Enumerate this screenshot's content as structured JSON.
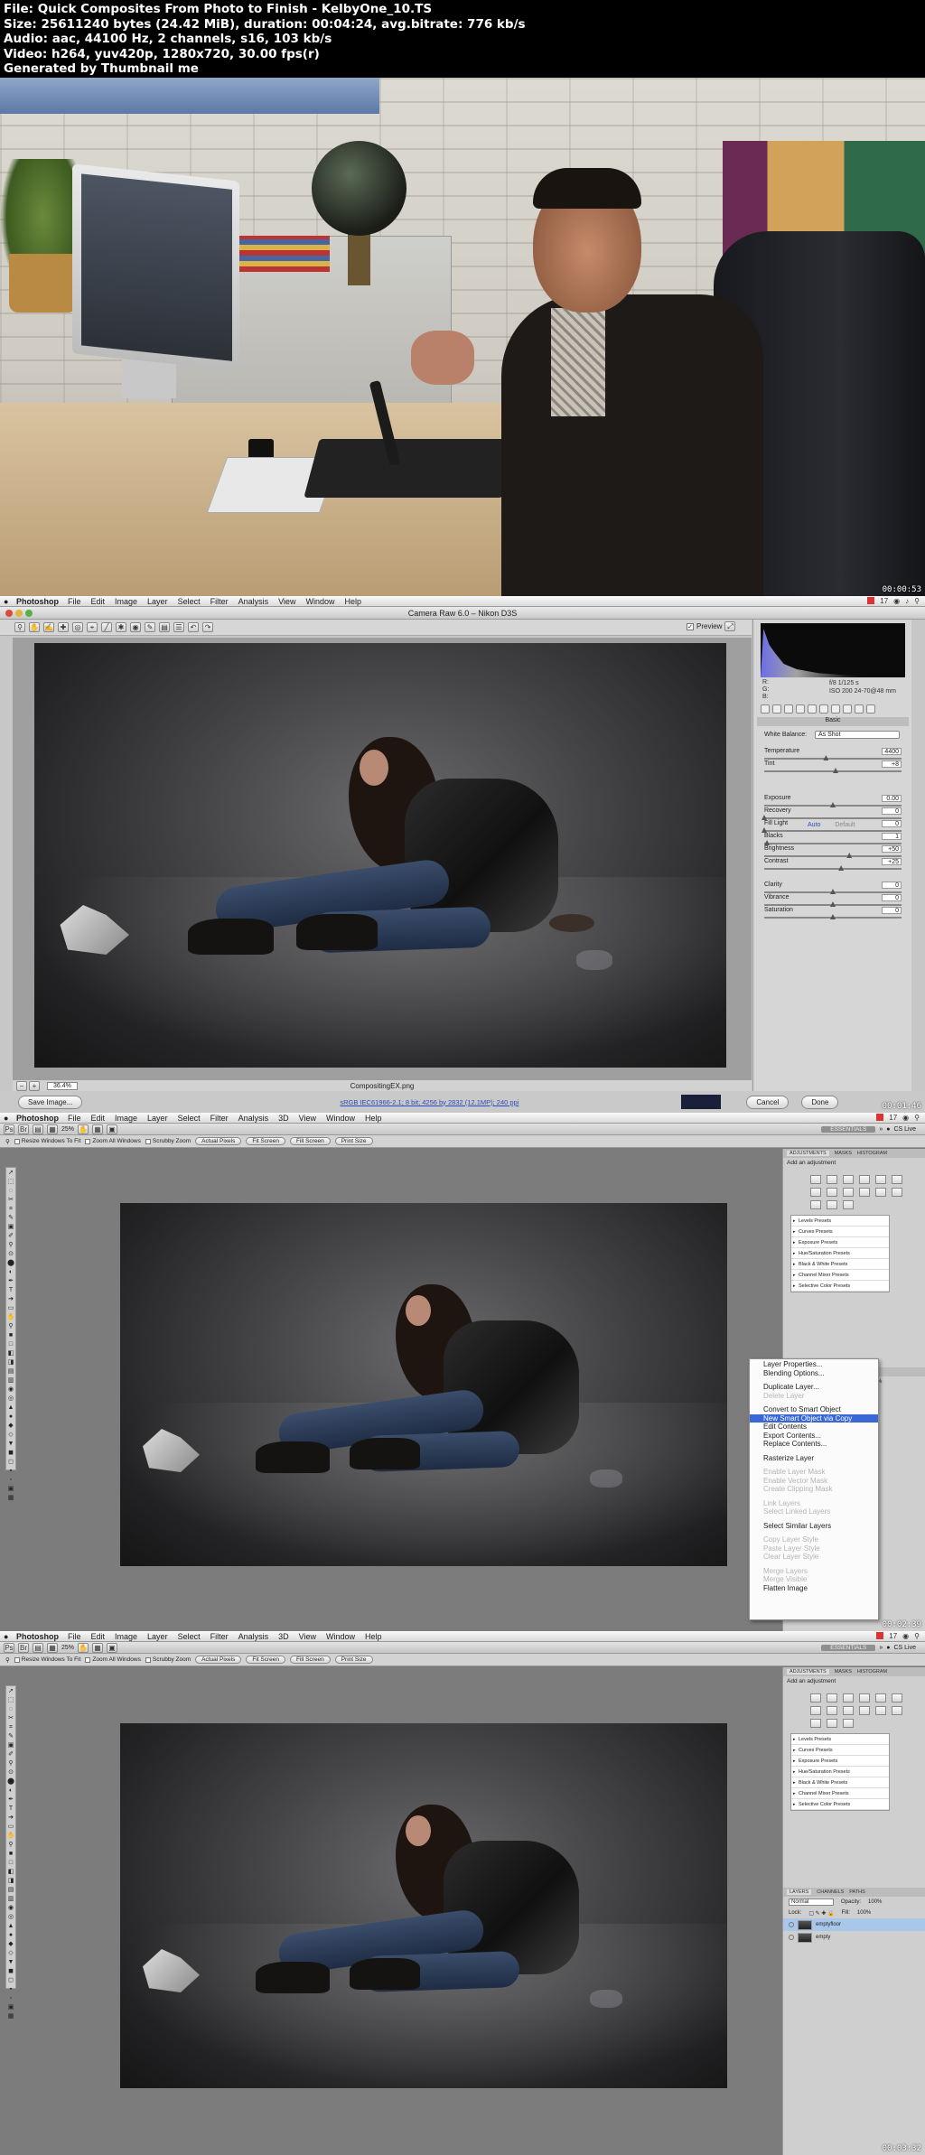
{
  "info": {
    "line1": "File: Quick Composites From Photo to Finish - KelbyOne_10.TS",
    "line2": "Size: 25611240 bytes (24.42 MiB), duration: 00:04:24, avg.bitrate: 776 kb/s",
    "line3": "Audio: aac, 44100 Hz, 2 channels, s16, 103 kb/s",
    "line4": "Video: h264, yuv420p, 1280x720, 30.00 fps(r)",
    "line5": "Generated by Thumbnail me"
  },
  "timestamps": [
    "00:00:53",
    "00:01:46",
    "00:02:39",
    "00:03:32"
  ],
  "menubar": {
    "app": "Photoshop",
    "items": [
      "File",
      "Edit",
      "Image",
      "Layer",
      "Select",
      "Filter",
      "Analysis",
      "View",
      "Window",
      "Help"
    ],
    "items_3d": [
      "File",
      "Edit",
      "Image",
      "Layer",
      "Select",
      "Filter",
      "Analysis",
      "3D",
      "View",
      "Window",
      "Help"
    ],
    "clock": "17"
  },
  "camera_raw": {
    "title": "Camera Raw 6.0  –  Nikon D3S",
    "preview_label": "Preview",
    "zoom": "36.4%",
    "filename": "CompositingEX.png",
    "workflow_link": "sRGB IEC61966-2.1; 8 bit; 4256 by 2832 (12.1MP); 240 ppi",
    "save_button": "Save Image...",
    "cancel_button": "Cancel",
    "done_button": "Done",
    "readout_rgb": [
      "R:",
      "G:",
      "B:"
    ],
    "camera_info": [
      "f/8    1/125 s",
      "ISO 200   24-70@48 mm"
    ],
    "panel_title": "Basic",
    "white_balance_label": "White Balance:",
    "white_balance_value": "As Shot",
    "auto_label": "Auto",
    "default_label": "Default",
    "sliders": [
      {
        "label": "Temperature",
        "value": "4400",
        "pos": 0.45
      },
      {
        "label": "Tint",
        "value": "+8",
        "pos": 0.52
      },
      {
        "label": "Exposure",
        "value": "0.00",
        "pos": 0.5
      },
      {
        "label": "Recovery",
        "value": "0",
        "pos": 0.0
      },
      {
        "label": "Fill Light",
        "value": "0",
        "pos": 0.0
      },
      {
        "label": "Blacks",
        "value": "1",
        "pos": 0.02
      },
      {
        "label": "Brightness",
        "value": "+50",
        "pos": 0.62
      },
      {
        "label": "Contrast",
        "value": "+25",
        "pos": 0.56
      },
      {
        "label": "Clarity",
        "value": "0",
        "pos": 0.5
      },
      {
        "label": "Vibrance",
        "value": "0",
        "pos": 0.5
      },
      {
        "label": "Saturation",
        "value": "0",
        "pos": 0.5
      }
    ]
  },
  "ps": {
    "zoom": "25%",
    "essentials": "ESSENTIALS",
    "cs_live": "CS Live",
    "options": [
      "Resize Windows To Fit",
      "Zoom All Windows",
      "Scrubby Zoom"
    ],
    "option_buttons": [
      "Actual Pixels",
      "Fit Screen",
      "Fill Screen",
      "Print Size"
    ],
    "adj_tabs": [
      "ADJUSTMENTS",
      "MASKS",
      "HISTOGRAM"
    ],
    "adj_title": "Add an adjustment",
    "presets": [
      "Levels Presets",
      "Curves Presets",
      "Exposure Presets",
      "Hue/Saturation Presets",
      "Black & White Presets",
      "Channel Mixer Presets",
      "Selective Color Presets"
    ],
    "layer_tabs": [
      "LAYERS",
      "CHANNELS",
      "PATHS"
    ],
    "blend": "Normal",
    "opacity_label": "Opacity:",
    "opacity": "100%",
    "fill_label": "Fill:",
    "lock_label": "Lock:",
    "layers": [
      "empty",
      "emptyfloor"
    ]
  },
  "context_menu": [
    {
      "label": "Layer Properties...",
      "state": "normal"
    },
    {
      "label": "Blending Options...",
      "state": "normal"
    },
    {
      "sep": true
    },
    {
      "label": "Duplicate Layer...",
      "state": "normal"
    },
    {
      "label": "Delete Layer",
      "state": "disabled"
    },
    {
      "sep": true
    },
    {
      "label": "Convert to Smart Object",
      "state": "normal"
    },
    {
      "label": "New Smart Object via Copy",
      "state": "highlight"
    },
    {
      "label": "Edit Contents",
      "state": "normal"
    },
    {
      "label": "Export Contents...",
      "state": "normal"
    },
    {
      "label": "Replace Contents...",
      "state": "normal"
    },
    {
      "sep": true
    },
    {
      "label": "Rasterize Layer",
      "state": "normal"
    },
    {
      "sep": true
    },
    {
      "label": "Enable Layer Mask",
      "state": "disabled"
    },
    {
      "label": "Enable Vector Mask",
      "state": "disabled"
    },
    {
      "label": "Create Clipping Mask",
      "state": "disabled"
    },
    {
      "sep": true
    },
    {
      "label": "Link Layers",
      "state": "disabled"
    },
    {
      "label": "Select Linked Layers",
      "state": "disabled"
    },
    {
      "sep": true
    },
    {
      "label": "Select Similar Layers",
      "state": "normal"
    },
    {
      "sep": true
    },
    {
      "label": "Copy Layer Style",
      "state": "disabled"
    },
    {
      "label": "Paste Layer Style",
      "state": "disabled"
    },
    {
      "label": "Clear Layer Style",
      "state": "disabled"
    },
    {
      "sep": true
    },
    {
      "label": "Merge Layers",
      "state": "disabled"
    },
    {
      "label": "Merge Visible",
      "state": "disabled"
    },
    {
      "label": "Flatten Image",
      "state": "normal"
    }
  ]
}
